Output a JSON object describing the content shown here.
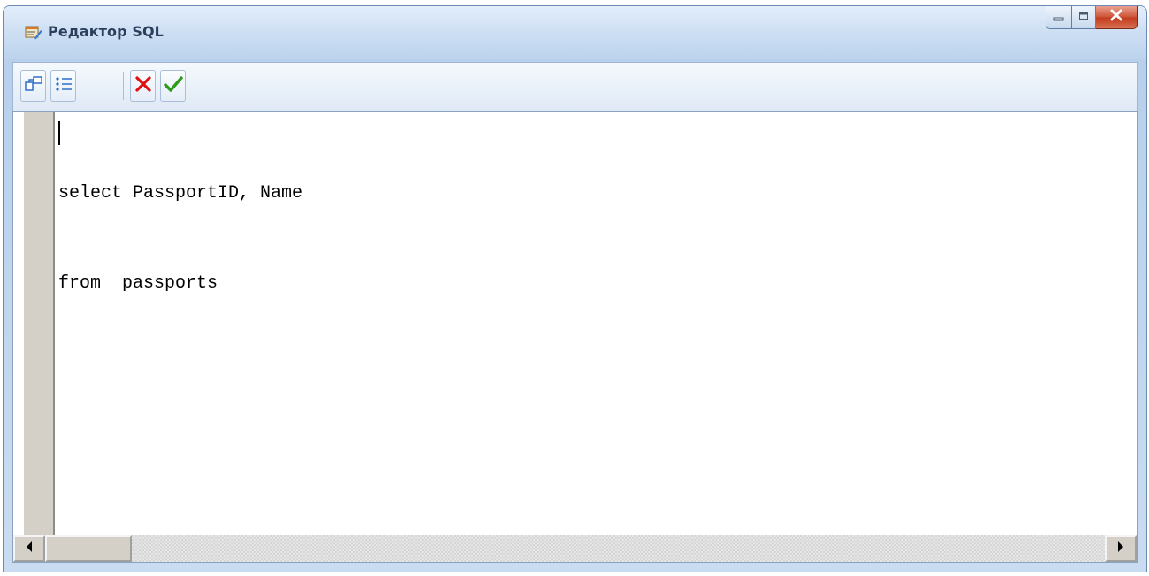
{
  "window": {
    "title": "Редактор SQL",
    "icon": "sql-editor-app-icon"
  },
  "window_controls": {
    "minimize_icon": "minimize-icon",
    "maximize_icon": "maximize-icon",
    "close_icon": "close-icon",
    "close_glyph": "x"
  },
  "toolbar": {
    "buttons": [
      {
        "name": "query-builder-button",
        "icon": "query-builder-icon"
      },
      {
        "name": "list-view-button",
        "icon": "list-icon"
      },
      {
        "name": "cancel-button",
        "icon": "red-x-icon"
      },
      {
        "name": "apply-button",
        "icon": "green-check-icon"
      }
    ]
  },
  "editor": {
    "lines": [
      "select PassportID, Name",
      "from  passports"
    ]
  },
  "colors": {
    "cancel_red": "#e01010",
    "apply_green": "#2c9a1a",
    "title_text": "#2b3f5c"
  }
}
